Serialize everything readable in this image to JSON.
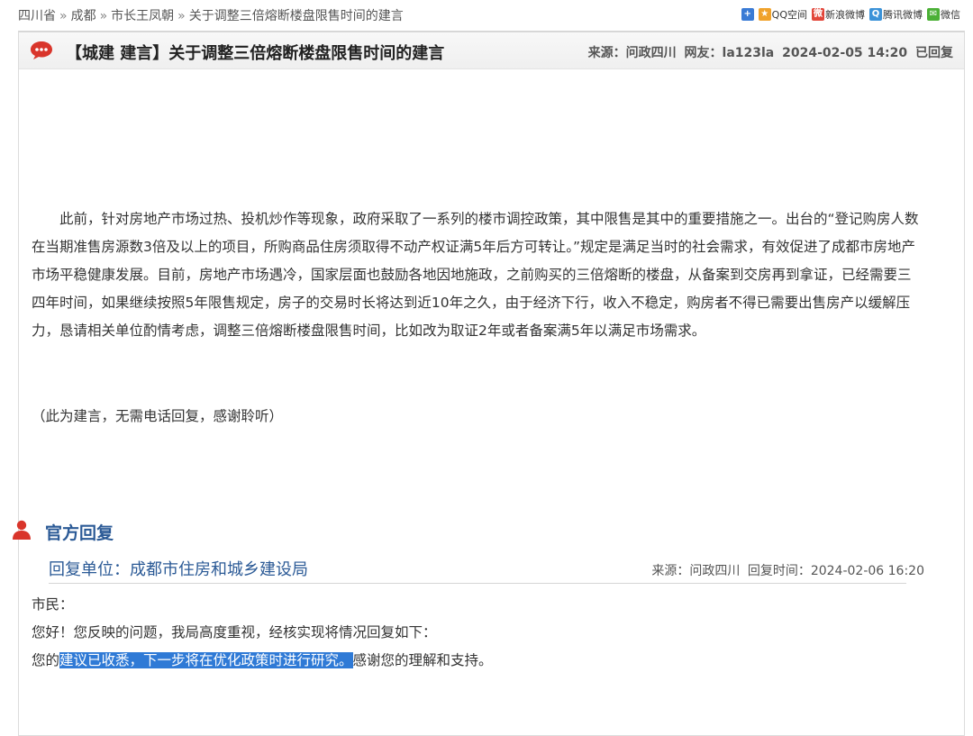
{
  "breadcrumb": {
    "items": [
      "四川省",
      "成都",
      "市长王凤朝",
      "关于调整三倍熔断楼盘限售时间的建言"
    ],
    "separator": "»"
  },
  "share": {
    "items": [
      {
        "icon": "plus-icon",
        "label": "",
        "color": "#3a7bd5"
      },
      {
        "icon": "qzone-icon",
        "label": "QQ空间",
        "color": "#f0a22b"
      },
      {
        "icon": "weibo-icon",
        "label": "新浪微博",
        "color": "#e2463a"
      },
      {
        "icon": "tencent-weibo-icon",
        "label": "腾讯微博",
        "color": "#3b92d8"
      },
      {
        "icon": "wechat-icon",
        "label": "微信",
        "color": "#4bb036"
      }
    ]
  },
  "post": {
    "title": "【城建 建言】关于调整三倍熔断楼盘限售时间的建言",
    "source": "来源：问政四川",
    "user": "网友：la123la",
    "datetime": "2024-02-05 14:20",
    "status": "已回复",
    "body": "此前，针对房地产市场过热、投机炒作等现象，政府采取了一系列的楼市调控政策，其中限售是其中的重要措施之一。出台的“登记购房人数在当期准售房源数3倍及以上的项目，所购商品住房须取得不动产权证满5年后方可转让。”规定是满足当时的社会需求，有效促进了成都市房地产市场平稳健康发展。目前，房地产市场遇冷，国家层面也鼓励各地因地施政，之前购买的三倍熔断的楼盘，从备案到交房再到拿证，已经需要三四年时间，如果继续按照5年限售规定，房子的交易时长将达到近10年之久，由于经济下行，收入不稳定，购房者不得已需要出售房产以缓解压力，恳请相关单位酌情考虑，调整三倍熔断楼盘限售时间，比如改为取证2年或者备案满5年以满足市场需求。",
    "note": "（此为建言，无需电话回复，感谢聆听）"
  },
  "reply": {
    "heading": "官方回复",
    "unit": "回复单位：成都市住房和城乡建设局",
    "source": "来源：问政四川",
    "time": "回复时间：2024-02-06 16:20",
    "greeting": "市民：",
    "line1": "您好！您反映的问题，我局高度重视，经核实现将情况回复如下：",
    "line2_pre": "您的",
    "line2_selected": "建议已收悉，下一步将在优化政策时进行研究。",
    "line2_post": "感谢您的理解和支持。"
  },
  "colors": {
    "accent_blue": "#2b5a96",
    "bubble_red": "#d9352b",
    "selection": "#2f7ad6"
  }
}
